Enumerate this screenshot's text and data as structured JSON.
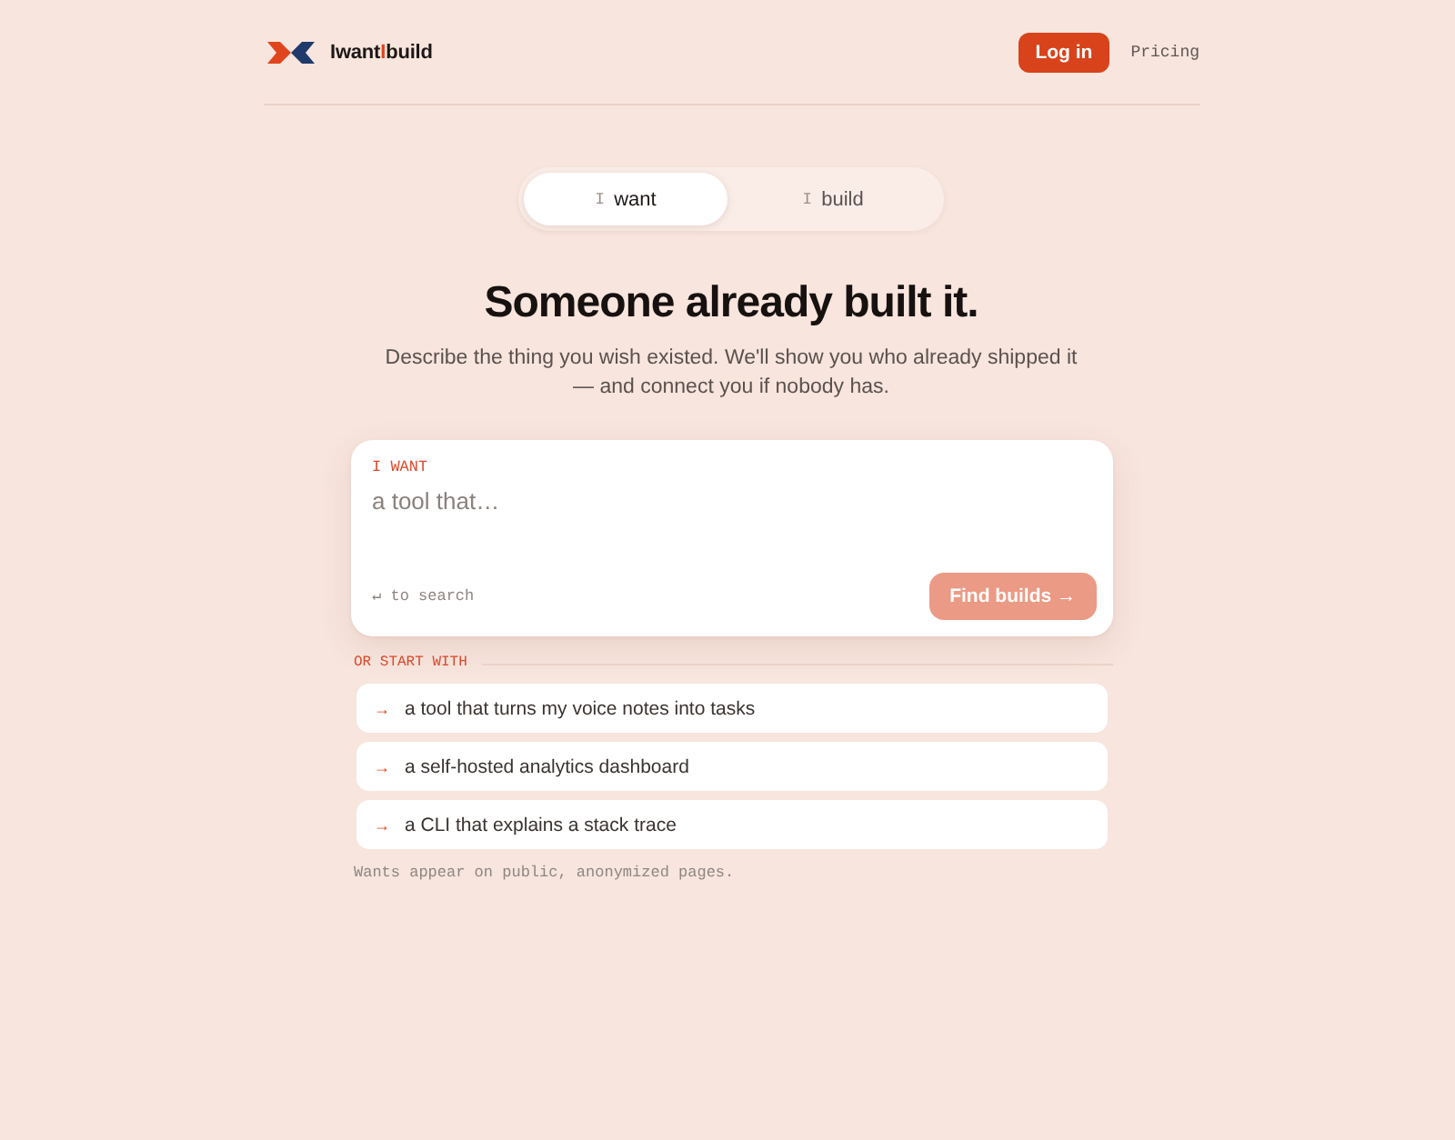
{
  "header": {
    "logo": [
      {
        "text": "Iwant",
        "accent": false
      },
      {
        "text": "I",
        "accent": true
      },
      {
        "text": "build",
        "accent": false
      }
    ],
    "login": "Log in",
    "links": [
      "Pricing"
    ]
  },
  "mode_toggle": [
    {
      "glyph": "I",
      "label": "want",
      "selected": true
    },
    {
      "glyph": "I",
      "label": "build",
      "selected": false
    }
  ],
  "hero": {
    "title": "Someone already built it.",
    "subtitle": "Describe the thing you wish existed. We'll show you who already shipped it — and connect you if nobody has."
  },
  "search": {
    "label": "I WANT",
    "placeholder": "a tool that…",
    "hint": "↵ to search",
    "button": {
      "label": "Find builds →",
      "disabled": true
    }
  },
  "suggestions": {
    "label": "OR START WITH",
    "items": [
      {
        "arrow": "→",
        "text": "a tool that turns my voice notes into tasks"
      },
      {
        "arrow": "→",
        "text": "a self-hosted analytics dashboard"
      },
      {
        "arrow": "→",
        "text": "a CLI that explains a stack trace"
      }
    ]
  },
  "footer_note": "Wants appear on public, anonymized pages."
}
